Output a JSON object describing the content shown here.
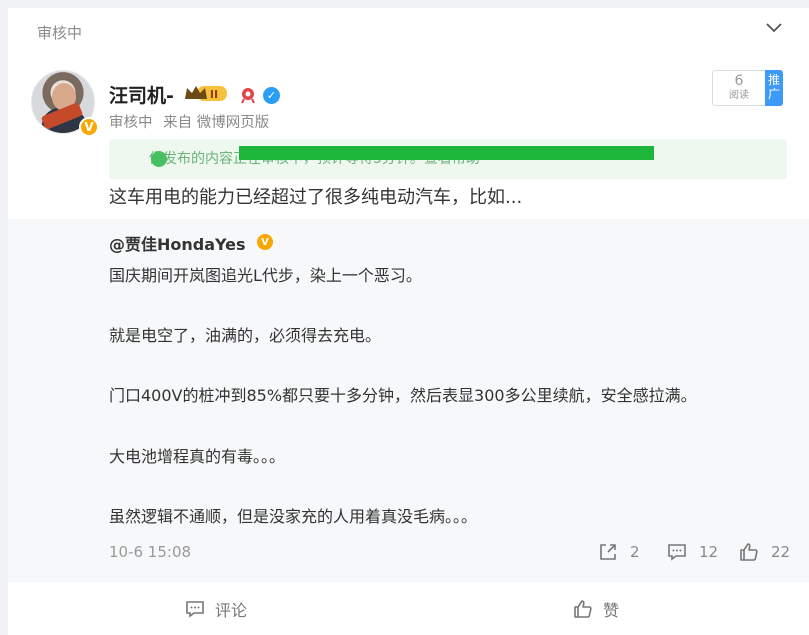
{
  "header": {
    "status": "审核中"
  },
  "author": {
    "name": "汪司机-",
    "vip_level": "II",
    "verified_badge": "V",
    "status": "审核中",
    "source": "来自 微博网页版"
  },
  "read_count": {
    "value": "6",
    "label": "阅读"
  },
  "promote_label": "推广",
  "notice": {
    "text": "你发布的内容正在审核中，预计等待5分钟。查看帮助"
  },
  "post": {
    "text": "这车用电的能力已经超过了很多纯电动汽车，比如..."
  },
  "repost": {
    "user": "@贾佳HondaYes",
    "badge": "V",
    "paragraphs": [
      "国庆期间开岚图追光L代步，染上一个恶习。",
      "就是电空了，油满的，必须得去充电。",
      "门口400V的桩冲到85%都只要十多分钟，然后表显300多公里续航，安全感拉满。",
      "大电池增程真的有毒。。。",
      "虽然逻辑不通顺，但是没家充的人用着真没毛病。。。"
    ],
    "timestamp": "10-6 15:08",
    "stats": {
      "shares": "2",
      "comments": "12",
      "likes": "22"
    }
  },
  "footer": {
    "comment_label": "评论",
    "like_label": "赞"
  },
  "colors": {
    "accent": "#3d9af7",
    "green_notice": "#1db53a",
    "badge": "#f7a700"
  }
}
